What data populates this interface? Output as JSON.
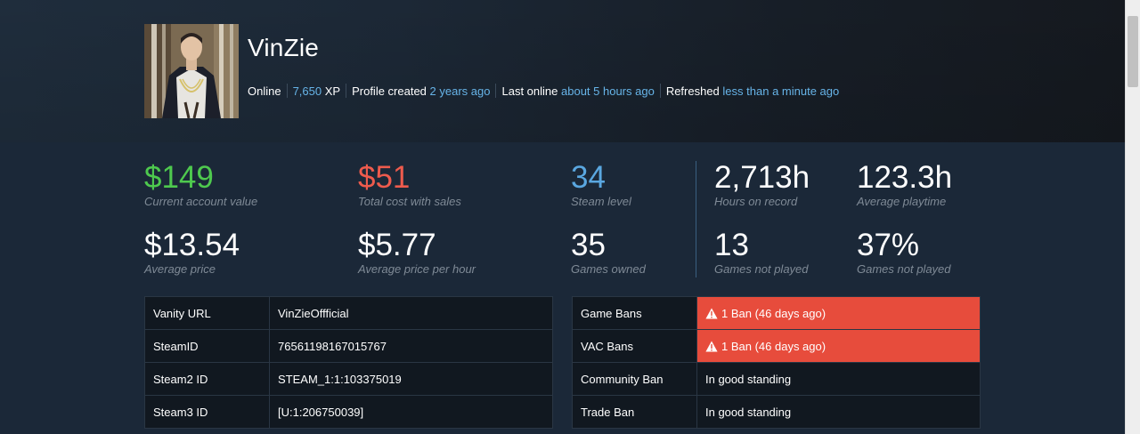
{
  "profile": {
    "username": "VinZie",
    "status": "Online",
    "xp_value": "7,650",
    "xp_label": "XP",
    "created_label": "Profile created",
    "created_value": "2 years ago",
    "last_online_label": "Last online",
    "last_online_value": "about 5 hours ago",
    "refreshed_label": "Refreshed",
    "refreshed_value": "less than a minute ago"
  },
  "stats": [
    {
      "value": "$149",
      "label": "Current account value"
    },
    {
      "value": "$51",
      "label": "Total cost with sales"
    },
    {
      "value": "34",
      "label": "Steam level"
    },
    {
      "value": "2,713h",
      "label": "Hours on record"
    },
    {
      "value": "123.3h",
      "label": "Average playtime"
    },
    {
      "value": "$13.54",
      "label": "Average price"
    },
    {
      "value": "$5.77",
      "label": "Average price per hour"
    },
    {
      "value": "35",
      "label": "Games owned"
    },
    {
      "value": "13",
      "label": "Games not played"
    },
    {
      "value": "37%",
      "label": "Games not played"
    }
  ],
  "ids": [
    {
      "key": "Vanity URL",
      "value": "VinZieOffficial"
    },
    {
      "key": "SteamID",
      "value": "76561198167015767"
    },
    {
      "key": "Steam2 ID",
      "value": "STEAM_1:1:103375019"
    },
    {
      "key": "Steam3 ID",
      "value": "[U:1:206750039]"
    }
  ],
  "bans": [
    {
      "key": "Game Bans",
      "value": "1 Ban (46 days ago)"
    },
    {
      "key": "VAC Bans",
      "value": "1 Ban (46 days ago)"
    },
    {
      "key": "Community Ban",
      "value": "In good standing"
    },
    {
      "key": "Trade Ban",
      "value": "In good standing"
    }
  ],
  "colors": {
    "background": "#1b2838",
    "positive": "#4ec94e",
    "negative": "#ee5b4d",
    "accent": "#5aa7e0",
    "link": "#67b4e8",
    "ban": "#e74c3c"
  },
  "icons": {
    "warning": "warning-triangle-icon"
  }
}
